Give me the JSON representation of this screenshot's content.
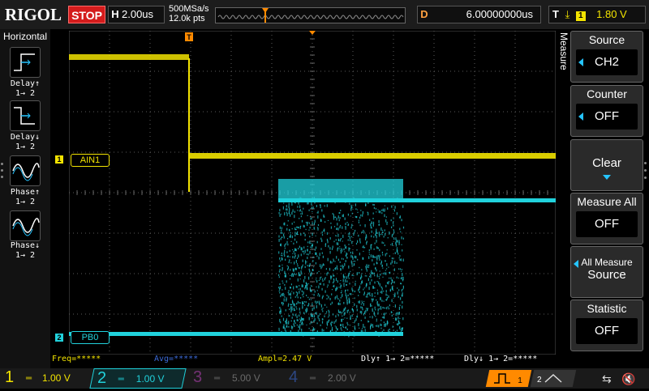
{
  "topbar": {
    "brand": "RIGOL",
    "run_state": "STOP",
    "horizontal_key": "H",
    "timebase": "2.00us",
    "sample_rate": "500MSa/s",
    "memory_depth": "12.0k pts",
    "delay_key": "D",
    "delay_value": "6.00000000us",
    "trigger_key": "T",
    "trigger_channel": "1",
    "trigger_level": "1.80 V"
  },
  "left_panel": {
    "title": "Horizontal",
    "buttons": [
      {
        "label": "Delay",
        "sub": "1→ 2",
        "icon": "delay-rising-icon"
      },
      {
        "label": "Delay",
        "sub": "1→ 2",
        "icon": "delay-falling-icon"
      },
      {
        "label": "Phase",
        "sub": "1→ 2",
        "icon": "phase-rising-icon"
      },
      {
        "label": "Phase",
        "sub": "1→ 2",
        "icon": "phase-falling-icon"
      }
    ]
  },
  "channels_on_screen": {
    "ch1_label": "AIN1",
    "ch1_marker": "1",
    "ch2_label": "PB0",
    "ch2_marker": "2"
  },
  "measure_menu": {
    "tab_label": "Measure",
    "items": [
      {
        "title": "Source",
        "value": "CH2"
      },
      {
        "title": "Counter",
        "value": "OFF"
      },
      {
        "title": "",
        "value": "Clear"
      },
      {
        "title": "Measure All",
        "value": "OFF"
      },
      {
        "title": "All Measure",
        "value": "Source"
      },
      {
        "title": "Statistic",
        "value": "OFF"
      }
    ]
  },
  "measurements": {
    "freq": "Freq=*****",
    "avg": "Avg=*****",
    "ampl": "Ampl=2.47 V",
    "dly_rise": "Dly↑ 1→ 2=*****",
    "dly_fall": "Dly↓ 1→ 2=*****"
  },
  "bottom_bar": {
    "ch1": {
      "num": "1",
      "scale": "1.00 V"
    },
    "ch2": {
      "num": "2",
      "scale": "1.00 V"
    },
    "ch3": {
      "num": "3",
      "scale": "5.00 V"
    },
    "ch4": {
      "num": "4",
      "scale": "2.00 V"
    }
  },
  "colors": {
    "ch1": "#f2e300",
    "ch2": "#21d2dc",
    "ch3": "#c045c0",
    "ch4": "#3c6bd8",
    "trigger_marker": "#ff8a00",
    "stop": "#d41c1c"
  }
}
